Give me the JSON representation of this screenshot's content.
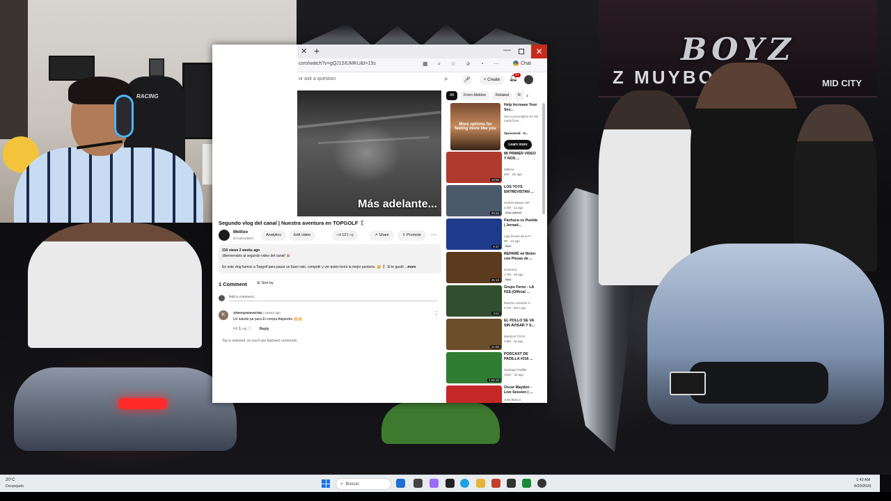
{
  "wallpaper": {
    "banner_text": "BOYZ",
    "banner_sub": "Z MUYBOYZ",
    "banner_corner": "MID CITY",
    "plate_text": "CarMax",
    "chair_text": "RACING"
  },
  "browser": {
    "tab_close": "✕",
    "tab_new": "+",
    "window_min": "—",
    "window_close": "✕",
    "url": "com/watch?v=gQJ1SIUMKU&t=15s",
    "chat_label": "Chat"
  },
  "youtube": {
    "search_placeholder": "or ask a question",
    "create_label": "+ Create",
    "notif_count": "9+",
    "player_caption": "Más adelante...",
    "video_title": "Segundo vlog del canal | Nuestra aventura en TOPGOLF 🏌",
    "channel_name": "Melitoo",
    "subscribers": "94 subscribers",
    "analytics_label": "Analytics",
    "edit_video_label": "Edit video",
    "likes": "12",
    "share_label": "Share",
    "promote_label": "Promote",
    "description": {
      "meta": "210 views  2 weeks ago",
      "line1": "¡Bienvenidos al segundo video del canal! 🎉",
      "line2": "En este vlog fuimos a Topgolf para pasar un buen rato, competir y ver quién tenía la mejor puntería. 🥳 🏌 Si te gustó ...",
      "more": "more"
    },
    "comments": {
      "count_label": "1 Comment",
      "sort_label": "Sort by",
      "add_placeholder": "Add a comment...",
      "items": [
        {
          "avatar_letter": "K",
          "author": "@kennyestevez764",
          "time": "2 weeks ago",
          "text": "Un saludo pa para El compa Alejandro 💥💥",
          "likes": "1",
          "reply_label": "Reply"
        }
      ],
      "top_note": "Top is selected, so you'll see featured comments"
    },
    "chips": [
      "All",
      "From Melitoo",
      "Related",
      "R"
    ],
    "ad": {
      "thumb_text": "More options for feeling more like you",
      "title": "Help Increase Your Sex...",
      "desc": "Get a prescription for ED meds from...",
      "sponsored": "Sponsored · H...",
      "cta": "Learn more"
    },
    "recommendations": [
      {
        "title": "MI PRIMER VIDEO Y NOS ...",
        "channel": "Melitoo",
        "views": "202 · 2w ago",
        "duration": "18:56",
        "badge": "",
        "color": "#b03a2e"
      },
      {
        "title": "LOS TOYS ENTREVISTAN ...",
        "channel": "GOOD MUSIC MT",
        "views": "2.4M · 1y ago",
        "duration": "29:25",
        "badge": "Auto-dubbed",
        "color": "#4a5a6a"
      },
      {
        "title": "Pachuca vs Puebla | Jornad...",
        "channel": "Liga Dunes de la P...",
        "views": "90 · 1d ago",
        "duration": "8:37",
        "badge": "New",
        "color": "#1e3a8a"
      },
      {
        "title": "REPARÉ mi Motor con Piezas de ...",
        "channel": "Nestorne",
        "views": "1.7M · 3d ago",
        "duration": "45:19",
        "badge": "New",
        "color": "#5b3a1e"
      },
      {
        "title": "Grupo Feroz - LA FE$ (Official ...",
        "channel": "Rancho Humilde ✔",
        "views": "3.7M · 8mo ago",
        "duration": "3:04",
        "badge": "",
        "color": "#2f4f2f"
      },
      {
        "title": "EL POLLO SE VA SIN AVISAR Y S...",
        "channel": "Markitos TOYS",
        "views": "3.8M · 3y ago",
        "duration": "21:59",
        "badge": "",
        "color": "#6b4f2a"
      },
      {
        "title": "PODCAST DE PADILLA #316 ...",
        "channel": "Santiago Padilla",
        "views": "131K · 3y ago",
        "duration": "1:06:29",
        "badge": "",
        "color": "#2e7d32"
      },
      {
        "title": "Oscar Maydon - Live Session | ...",
        "channel": "Julio Blanco",
        "views": "",
        "duration": "",
        "badge": "",
        "color": "#c62828"
      }
    ]
  },
  "taskbar": {
    "temperature": "20°C",
    "weather": "Despejado",
    "search_label": "Buscar",
    "time": "1:43 AM",
    "date": "8/20/2026"
  }
}
